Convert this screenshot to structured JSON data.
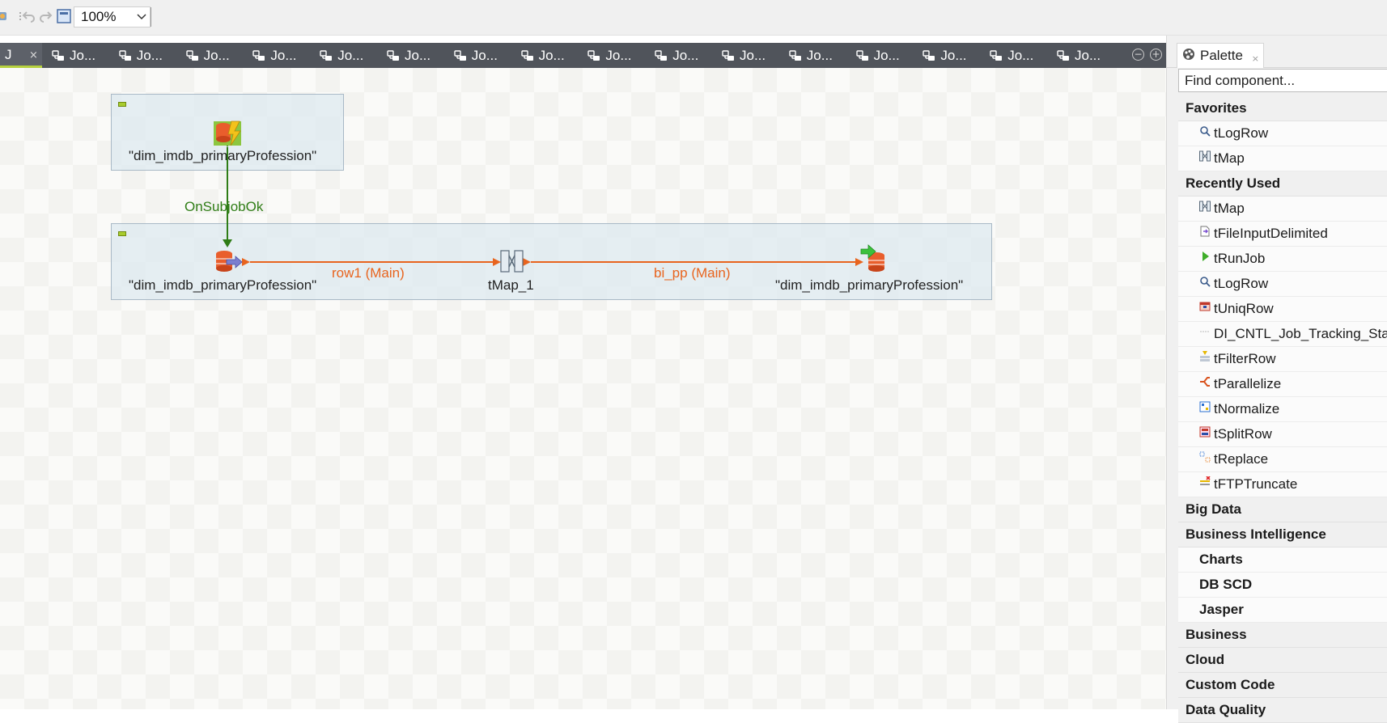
{
  "toolbar": {
    "zoom_value": "100%",
    "icons": [
      "job-icon",
      "undo-icon",
      "redo-icon",
      "page-icon",
      "chevron-down-icon"
    ]
  },
  "editor_tabs": {
    "active_label": "J",
    "active_close": "×",
    "tabs": [
      "Jo...",
      "Jo...",
      "Jo...",
      "Jo...",
      "Jo...",
      "Jo...",
      "Jo...",
      "Jo...",
      "Jo...",
      "Jo...",
      "Jo...",
      "Jo...",
      "Jo...",
      "Jo...",
      "Jo...",
      "Jo..."
    ],
    "tab_icon": "job-icon",
    "minimize_symbol": "−",
    "maximize_symbol": "+"
  },
  "canvas": {
    "prejob_component_label": "\"dim_imdb_primaryProfession\"",
    "trigger_label": "OnSubjobOk",
    "input_component_label": "\"dim_imdb_primaryProfession\"",
    "row1_label": "row1 (Main)",
    "tmap_label": "tMap_1",
    "output_link_label": "bi_pp (Main)",
    "output_component_label": "\"dim_imdb_primaryProfession\"",
    "colors": {
      "trigger": "#2f7d16",
      "row_link": "#e8641e",
      "subjob_fill": "#dfeaf0",
      "subjob_border": "#a9b9c6"
    }
  },
  "palette": {
    "tab_label": "Palette",
    "tab_close": "×",
    "search_placeholder": "Find component...",
    "favorites_label": "Favorites",
    "favorites": [
      {
        "label": "tLogRow",
        "icon": "log-row-icon"
      },
      {
        "label": "tMap",
        "icon": "map-icon"
      }
    ],
    "recent_label": "Recently Used",
    "recent": [
      {
        "label": "tMap",
        "icon": "map-icon"
      },
      {
        "label": "tFileInputDelimited",
        "icon": "file-input-icon"
      },
      {
        "label": "tRunJob",
        "icon": "run-job-icon"
      },
      {
        "label": "tLogRow",
        "icon": "log-row-icon"
      },
      {
        "label": "tUniqRow",
        "icon": "uniq-row-icon"
      },
      {
        "label": "DI_CNTL_Job_Tracking_Stats",
        "icon": "joblet-icon"
      },
      {
        "label": "tFilterRow",
        "icon": "filter-row-icon"
      },
      {
        "label": "tParallelize",
        "icon": "parallelize-icon"
      },
      {
        "label": "tNormalize",
        "icon": "normalize-icon"
      },
      {
        "label": "tSplitRow",
        "icon": "split-row-icon"
      },
      {
        "label": "tReplace",
        "icon": "replace-icon"
      },
      {
        "label": "tFTPTruncate",
        "icon": "ftp-truncate-icon"
      }
    ],
    "groups": [
      "Big Data",
      "Business Intelligence"
    ],
    "bi_subgroups": [
      "Charts",
      "DB SCD",
      "Jasper"
    ],
    "groups_after": [
      "Business",
      "Cloud",
      "Custom Code",
      "Data Quality"
    ]
  }
}
